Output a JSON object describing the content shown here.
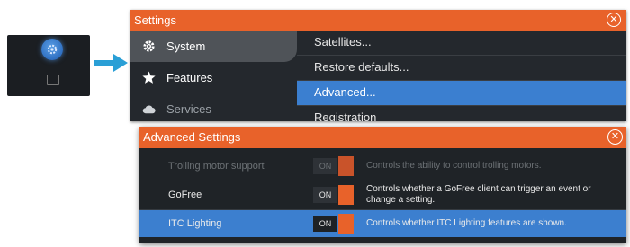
{
  "colors": {
    "accent_orange": "#e8622a",
    "selection_blue": "#3b7fd0",
    "panel_dark": "#24282d"
  },
  "home_thumbnail": {
    "button_icon": "settings-gear-icon"
  },
  "settings": {
    "title": "Settings",
    "close_icon": "close-circle-icon",
    "sidebar": [
      {
        "label": "System",
        "icon": "gear-icon",
        "active": true
      },
      {
        "label": "Features",
        "icon": "star-icon",
        "active": false
      },
      {
        "label": "Services",
        "icon": "cloud-icon",
        "active": false
      }
    ],
    "menu": [
      {
        "label": "Satellites..."
      },
      {
        "label": "Restore defaults..."
      },
      {
        "label": "Advanced...",
        "selected": true
      },
      {
        "label": "Registration"
      }
    ]
  },
  "advanced": {
    "title": "Advanced Settings",
    "close_icon": "close-circle-icon",
    "rows": [
      {
        "label": "Trolling motor support",
        "state": "ON",
        "description": "Controls the ability to control trolling motors.",
        "dimmed": true
      },
      {
        "label": "GoFree",
        "state": "ON",
        "description": "Controls whether a GoFree client can trigger an event or change a setting."
      },
      {
        "label": "ITC Lighting",
        "state": "ON",
        "description": "Controls whether ITC Lighting features are shown.",
        "selected": true
      }
    ]
  }
}
